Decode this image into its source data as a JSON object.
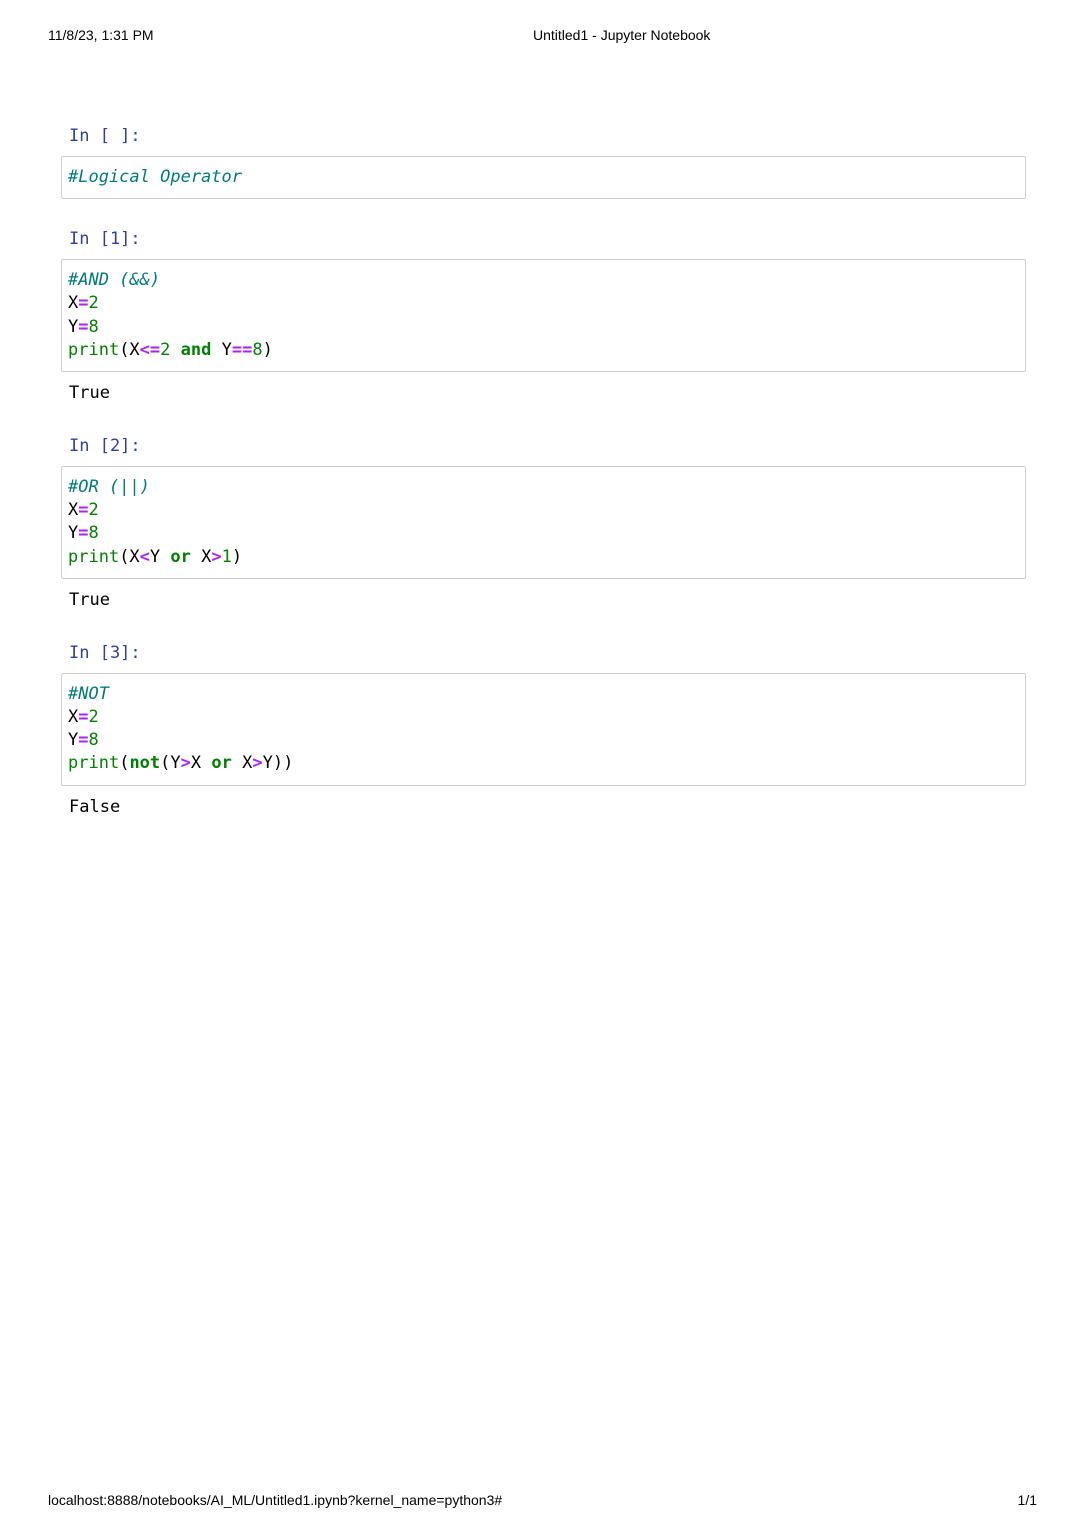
{
  "print_header": {
    "datetime": "11/8/23, 1:31 PM",
    "title": "Untitled1 - Jupyter Notebook"
  },
  "print_footer": {
    "url": "localhost:8888/notebooks/AI_ML/Untitled1.ipynb?kernel_name=python3#",
    "page": "1/1"
  },
  "cells": [
    {
      "prompt": "In [ ]:",
      "lines": [
        [
          {
            "t": "#Logical Operator",
            "c": "comment"
          }
        ]
      ],
      "output": null
    },
    {
      "prompt": "In [1]:",
      "lines": [
        [
          {
            "t": "#AND (&&)",
            "c": "comment"
          }
        ],
        [
          {
            "t": "X",
            "c": "var"
          },
          {
            "t": "=",
            "c": "operator"
          },
          {
            "t": "2",
            "c": "number"
          }
        ],
        [
          {
            "t": "Y",
            "c": "var"
          },
          {
            "t": "=",
            "c": "operator"
          },
          {
            "t": "8",
            "c": "number"
          }
        ],
        [
          {
            "t": "print",
            "c": "builtin"
          },
          {
            "t": "(X",
            "c": "var"
          },
          {
            "t": "<=",
            "c": "operator"
          },
          {
            "t": "2",
            "c": "number"
          },
          {
            "t": " ",
            "c": "var"
          },
          {
            "t": "and",
            "c": "keyword"
          },
          {
            "t": " Y",
            "c": "var"
          },
          {
            "t": "==",
            "c": "operator"
          },
          {
            "t": "8",
            "c": "number"
          },
          {
            "t": ")",
            "c": "var"
          }
        ]
      ],
      "output": "True"
    },
    {
      "prompt": "In [2]:",
      "lines": [
        [
          {
            "t": "#OR (||)",
            "c": "comment"
          }
        ],
        [
          {
            "t": "X",
            "c": "var"
          },
          {
            "t": "=",
            "c": "operator"
          },
          {
            "t": "2",
            "c": "number"
          }
        ],
        [
          {
            "t": "Y",
            "c": "var"
          },
          {
            "t": "=",
            "c": "operator"
          },
          {
            "t": "8",
            "c": "number"
          }
        ],
        [
          {
            "t": "print",
            "c": "builtin"
          },
          {
            "t": "(X",
            "c": "var"
          },
          {
            "t": "<",
            "c": "operator"
          },
          {
            "t": "Y ",
            "c": "var"
          },
          {
            "t": "or",
            "c": "keyword"
          },
          {
            "t": " X",
            "c": "var"
          },
          {
            "t": ">",
            "c": "operator"
          },
          {
            "t": "1",
            "c": "number"
          },
          {
            "t": ")",
            "c": "var"
          }
        ]
      ],
      "output": "True"
    },
    {
      "prompt": "In [3]:",
      "lines": [
        [
          {
            "t": "#NOT",
            "c": "comment"
          }
        ],
        [
          {
            "t": "X",
            "c": "var"
          },
          {
            "t": "=",
            "c": "operator"
          },
          {
            "t": "2",
            "c": "number"
          }
        ],
        [
          {
            "t": "Y",
            "c": "var"
          },
          {
            "t": "=",
            "c": "operator"
          },
          {
            "t": "8",
            "c": "number"
          }
        ],
        [
          {
            "t": "print",
            "c": "builtin"
          },
          {
            "t": "(",
            "c": "var"
          },
          {
            "t": "not",
            "c": "keyword"
          },
          {
            "t": "(Y",
            "c": "var"
          },
          {
            "t": ">",
            "c": "operator"
          },
          {
            "t": "X ",
            "c": "var"
          },
          {
            "t": "or",
            "c": "keyword"
          },
          {
            "t": " X",
            "c": "var"
          },
          {
            "t": ">",
            "c": "operator"
          },
          {
            "t": "Y))",
            "c": "var"
          }
        ]
      ],
      "output": "False"
    }
  ]
}
